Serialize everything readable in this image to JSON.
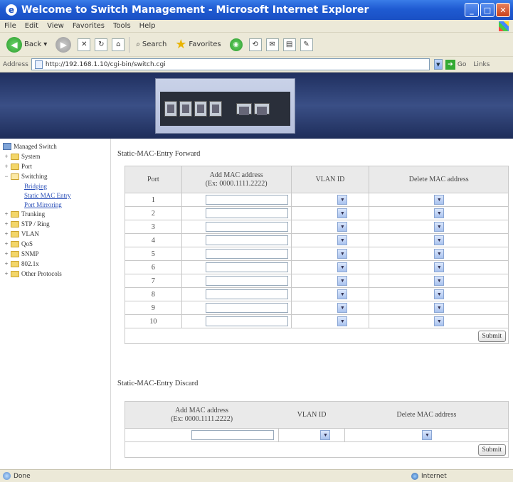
{
  "window": {
    "title": "Welcome to Switch Management - Microsoft Internet Explorer"
  },
  "menu": [
    "File",
    "Edit",
    "View",
    "Favorites",
    "Tools",
    "Help"
  ],
  "toolbar": {
    "back_label": "Back",
    "search_label": "Search",
    "favorites_label": "Favorites"
  },
  "address": {
    "label": "Address",
    "url": "http://192.168.1.10/cgi-bin/switch.cgi",
    "go_label": "Go",
    "links_label": "Links"
  },
  "sidebar": {
    "root": "Managed Switch",
    "items": [
      {
        "label": "System",
        "expanded": false
      },
      {
        "label": "Port",
        "expanded": false
      },
      {
        "label": "Switching",
        "expanded": true,
        "children": [
          "Bridging",
          "Static MAC Entry",
          "Port Mirroring"
        ]
      },
      {
        "label": "Trunking",
        "expanded": false
      },
      {
        "label": "STP / Ring",
        "expanded": false
      },
      {
        "label": "VLAN",
        "expanded": false
      },
      {
        "label": "QoS",
        "expanded": false
      },
      {
        "label": "SNMP",
        "expanded": false
      },
      {
        "label": "802.1x",
        "expanded": false
      },
      {
        "label": "Other Protocols",
        "expanded": false
      }
    ]
  },
  "forward": {
    "title": "Static-MAC-Entry Forward",
    "headers": {
      "port": "Port",
      "mac_line1": "Add MAC address",
      "mac_line2": "(Ex: 0000.1111.2222)",
      "vlan": "VLAN ID",
      "delete": "Delete MAC address"
    },
    "rows": [
      "1",
      "2",
      "3",
      "4",
      "5",
      "6",
      "7",
      "8",
      "9",
      "10"
    ],
    "submit_label": "Submit"
  },
  "discard": {
    "title": "Static-MAC-Entry Discard",
    "headers": {
      "mac_line1": "Add MAC address",
      "mac_line2": "(Ex: 0000.1111.2222)",
      "vlan": "VLAN ID",
      "delete": "Delete MAC address"
    },
    "submit_label": "Submit"
  },
  "status": {
    "left": "Done",
    "zone": "Internet"
  },
  "colors": {
    "titlebar": "#1f5bd2",
    "banner": "#2a3b6e",
    "link": "#2a4fb8",
    "table_header": "#eaeaea"
  }
}
